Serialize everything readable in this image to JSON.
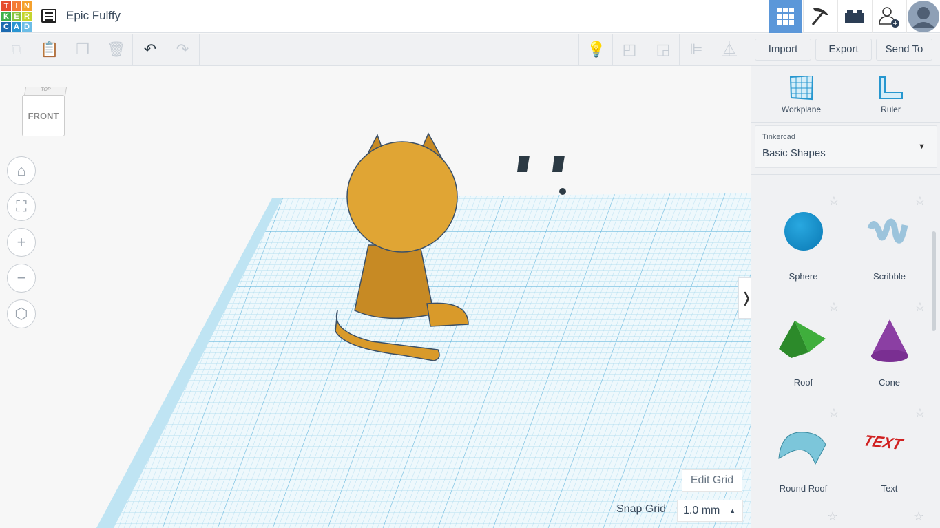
{
  "header": {
    "logo_letters": [
      "T",
      "I",
      "N",
      "K",
      "E",
      "R",
      "C",
      "A",
      "D"
    ],
    "logo_colors": [
      "#e64c2e",
      "#f47b36",
      "#f5a12d",
      "#3eb04a",
      "#8ac53f",
      "#c4d52f",
      "#1c6ab0",
      "#2b95d1",
      "#6cbde6"
    ],
    "title": "Epic Fulffy",
    "active_color": "#5b97d9"
  },
  "toolbar": {
    "import": "Import",
    "export": "Export",
    "send_to": "Send To"
  },
  "viewcube": {
    "front": "FRONT",
    "top": "TOP"
  },
  "grid": {
    "edit_grid": "Edit Grid",
    "snap_label": "Snap Grid",
    "snap_value": "1.0 mm"
  },
  "panel": {
    "workplane": "Workplane",
    "ruler": "Ruler",
    "library_label": "Tinkercad",
    "library_value": "Basic Shapes",
    "shapes": [
      {
        "label": "Sphere"
      },
      {
        "label": "Scribble"
      },
      {
        "label": "Roof"
      },
      {
        "label": "Cone"
      },
      {
        "label": "Round Roof"
      },
      {
        "label": "Text"
      }
    ],
    "text_shape_glyph": "TEXT"
  },
  "model": {
    "color": "#e0a534"
  }
}
